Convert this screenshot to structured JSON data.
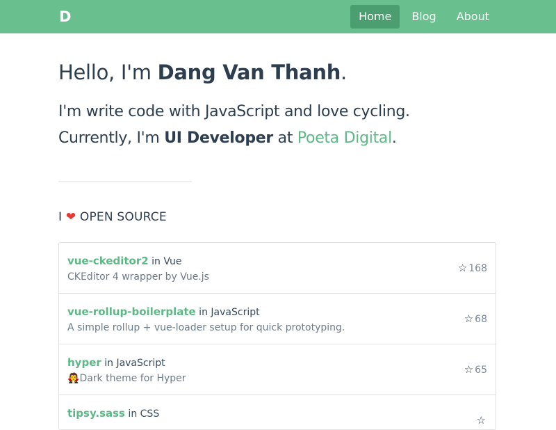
{
  "navbar": {
    "logo": "D",
    "links": [
      {
        "label": "Home"
      },
      {
        "label": "Blog"
      },
      {
        "label": "About"
      }
    ]
  },
  "hero": {
    "greeting": "Hello, I'm ",
    "name": "Dang Van Thanh",
    "greeting_end": "."
  },
  "intro": {
    "line1": "I'm write code with JavaScript and love cycling.",
    "line2_prefix": "Currently, I'm ",
    "role": "UI Developer",
    "at": " at ",
    "company": "Poeta Digital",
    "period": "."
  },
  "open_source": {
    "prefix": "I ",
    "heart": "❤",
    "suffix": " OPEN SOURCE"
  },
  "repos": [
    {
      "name": "vue-ckeditor2",
      "in": " in ",
      "language": "Vue",
      "description": "CKEditor 4 wrapper by Vue.js",
      "stars": "168"
    },
    {
      "name": "vue-rollup-boilerplate",
      "in": " in ",
      "language": "JavaScript",
      "description": "A simple rollup + vue-loader setup for quick prototyping.",
      "stars": "68"
    },
    {
      "name": "hyper",
      "in": " in ",
      "language": "JavaScript",
      "emoji": "🧛",
      "description": "Dark theme for Hyper",
      "stars": "65"
    },
    {
      "name": "tipsy.sass",
      "in": " in ",
      "language": "CSS",
      "description": "",
      "stars": ""
    }
  ],
  "colors": {
    "navbar": "#6abf8f",
    "accent": "#5cb885",
    "heart": "#e53935"
  }
}
